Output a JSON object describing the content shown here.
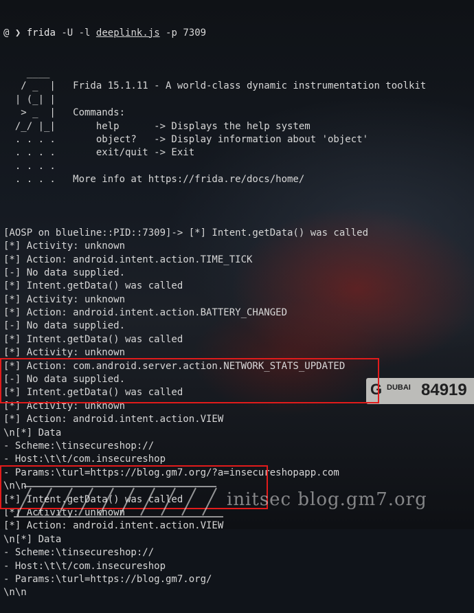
{
  "terminal": {
    "prompt_glyph": "@ ❯",
    "command": "frida",
    "args_pre": " -U -l ",
    "script": "deeplink.js",
    "args_post": " -p 7309"
  },
  "banner": [
    "    ____",
    "   / _  |   Frida 15.1.11 - A world-class dynamic instrumentation toolkit",
    "  | (_| |",
    "   > _  |   Commands:",
    "  /_/ |_|       help      -> Displays the help system",
    "  . . . .       object?   -> Display information about 'object'",
    "  . . . .       exit/quit -> Exit",
    "  . . . .",
    "  . . . .   More info at https://frida.re/docs/home/",
    ""
  ],
  "output": [
    "[AOSP on blueline::PID::7309]-> [*] Intent.getData() was called",
    "[*] Activity: unknown",
    "[*] Action: android.intent.action.TIME_TICK",
    "[-] No data supplied.",
    "[*] Intent.getData() was called",
    "[*] Activity: unknown",
    "[*] Action: android.intent.action.BATTERY_CHANGED",
    "[-] No data supplied.",
    "[*] Intent.getData() was called",
    "[*] Activity: unknown",
    "[*] Action: com.android.server.action.NETWORK_STATS_UPDATED",
    "[-] No data supplied.",
    "[*] Intent.getData() was called",
    "[*] Activity: unknown",
    "[*] Action: android.intent.action.VIEW",
    "\\n[*] Data",
    "- Scheme:\\tinsecureshop://",
    "- Host:\\t\\t/com.insecureshop",
    "- Params:\\turl=https://blog.gm7.org/?a=insecureshopapp.com",
    "\\n\\n",
    "[*] Intent.getData() was called",
    "[*] Activity: unknown",
    "[*] Action: android.intent.action.VIEW",
    "\\n[*] Data",
    "- Scheme:\\tinsecureshop://",
    "- Host:\\t\\t/com.insecureshop",
    "- Params:\\turl=https://blog.gm7.org/",
    "\\n\\n"
  ],
  "plate": {
    "letter": "G",
    "city": "DUBAI",
    "number": "84919"
  },
  "watermark": "initsec blog.gm7.org",
  "colors": {
    "highlight": "#e21b1b",
    "text": "#d7d7d7"
  }
}
